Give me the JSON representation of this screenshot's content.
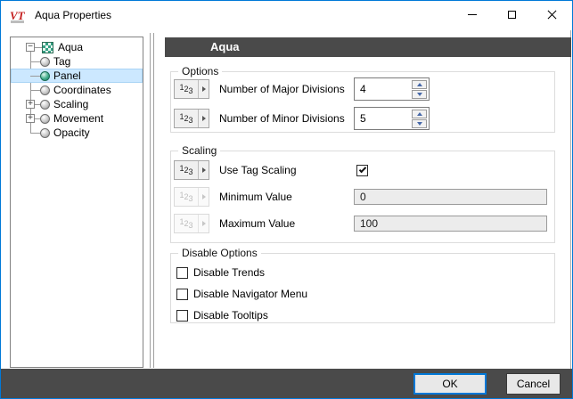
{
  "window": {
    "title": "Aqua Properties",
    "logo_text": "VT"
  },
  "tree": {
    "root": {
      "label": "Aqua",
      "expander": "−"
    },
    "items": [
      {
        "label": "Tag",
        "selected": false
      },
      {
        "label": "Panel",
        "selected": true
      },
      {
        "label": "Coordinates",
        "selected": false
      },
      {
        "label": "Scaling",
        "expander": "+",
        "selected": false
      },
      {
        "label": "Movement",
        "expander": "+",
        "selected": false
      },
      {
        "label": "Opacity",
        "selected": false
      }
    ]
  },
  "panel": {
    "header_title": "Aqua",
    "numeric_icon": {
      "d1": "1",
      "d2": "2",
      "d3": "3"
    },
    "options": {
      "title": "Options",
      "rows": [
        {
          "label": "Number of Major Divisions",
          "value": "4"
        },
        {
          "label": "Number of Minor Divisions",
          "value": "5"
        }
      ]
    },
    "scaling": {
      "title": "Scaling",
      "use_tag_scaling": {
        "label": "Use Tag Scaling",
        "checked": true
      },
      "minimum_value": {
        "label": "Minimum Value",
        "value": "0",
        "enabled": false
      },
      "maximum_value": {
        "label": "Maximum Value",
        "value": "100",
        "enabled": false
      }
    },
    "disable_options": {
      "title": "Disable Options",
      "items": [
        {
          "label": "Disable Trends",
          "checked": false
        },
        {
          "label": "Disable Navigator Menu",
          "checked": false
        },
        {
          "label": "Disable Tooltips",
          "checked": false
        }
      ]
    }
  },
  "footer": {
    "ok_label": "OK",
    "cancel_label": "Cancel"
  },
  "colors": {
    "accent": "#0078d7",
    "dark_bar": "#4a4a4a",
    "selection": "#cce8ff",
    "node_green": "#2f9e73",
    "disabled_field": "#ececec"
  }
}
